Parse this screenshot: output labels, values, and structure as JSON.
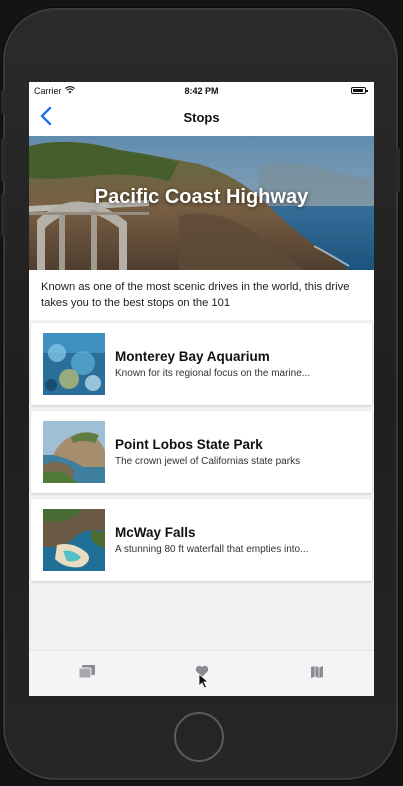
{
  "status_bar": {
    "carrier": "Carrier",
    "time": "8:42 PM"
  },
  "nav": {
    "title": "Stops",
    "back_icon": "chevron-left-icon"
  },
  "hero": {
    "title": "Pacific Coast Highway"
  },
  "intro": {
    "text": "Known as one of the most scenic drives in the world, this drive takes you to the best stops on the 101"
  },
  "stops": [
    {
      "title": "Monterey Bay Aquarium",
      "description": "Known for its regional focus on the marine..."
    },
    {
      "title": "Point Lobos State Park",
      "description": "The crown jewel of Californias state parks"
    },
    {
      "title": "McWay Falls",
      "description": "A stunning 80 ft waterfall that empties into..."
    }
  ],
  "tabs": [
    {
      "name": "list",
      "icon": "list-icon"
    },
    {
      "name": "favorites",
      "icon": "heart-icon"
    },
    {
      "name": "map",
      "icon": "map-icon"
    }
  ],
  "colors": {
    "accent": "#1a73e8",
    "tab_icon": "#8a8a8f"
  }
}
